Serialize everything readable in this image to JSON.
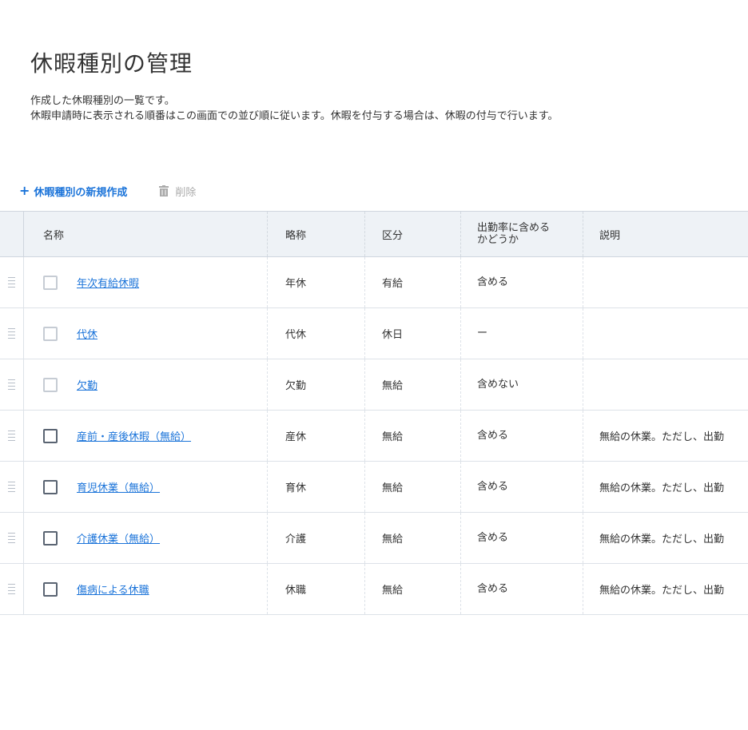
{
  "page": {
    "title": "休暇種別の管理",
    "description_line1": "作成した休暇種別の一覧です。",
    "description_line2": "休暇申請時に表示される順番はこの画面での並び順に従います。休暇を付与する場合は、休暇の付与で行います。"
  },
  "toolbar": {
    "add_icon": "plus-icon",
    "add_label": "休暇種別の新規作成",
    "delete_icon": "trash-icon",
    "delete_label": "削除"
  },
  "table": {
    "headers": {
      "name": "名称",
      "abbr": "略称",
      "kind": "区分",
      "attendance_line1": "出勤率に含める",
      "attendance_line2": "かどうか",
      "note": "説明"
    },
    "rows": [
      {
        "name": "年次有給休暇",
        "abbr": "年休",
        "kind": "有給",
        "attendance": "含める",
        "note": "",
        "checkbox_disabled": true
      },
      {
        "name": "代休",
        "abbr": "代休",
        "kind": "休日",
        "attendance": "ー",
        "note": "",
        "checkbox_disabled": true
      },
      {
        "name": "欠勤",
        "abbr": "欠勤",
        "kind": "無給",
        "attendance": "含めない",
        "note": "",
        "checkbox_disabled": true
      },
      {
        "name": "産前・産後休暇（無給）",
        "abbr": "産休",
        "kind": "無給",
        "attendance": "含める",
        "note": "無給の休業。ただし、出勤",
        "checkbox_disabled": false
      },
      {
        "name": "育児休業（無給）",
        "abbr": "育休",
        "kind": "無給",
        "attendance": "含める",
        "note": "無給の休業。ただし、出勤",
        "checkbox_disabled": false
      },
      {
        "name": "介護休業（無給）",
        "abbr": "介護",
        "kind": "無給",
        "attendance": "含める",
        "note": "無給の休業。ただし、出勤",
        "checkbox_disabled": false
      },
      {
        "name": "傷病による休職",
        "abbr": "休職",
        "kind": "無給",
        "attendance": "含める",
        "note": "無給の休業。ただし、出勤",
        "checkbox_disabled": false
      }
    ]
  },
  "colors": {
    "accent": "#1a73d9",
    "header_bg": "#eef2f6"
  }
}
